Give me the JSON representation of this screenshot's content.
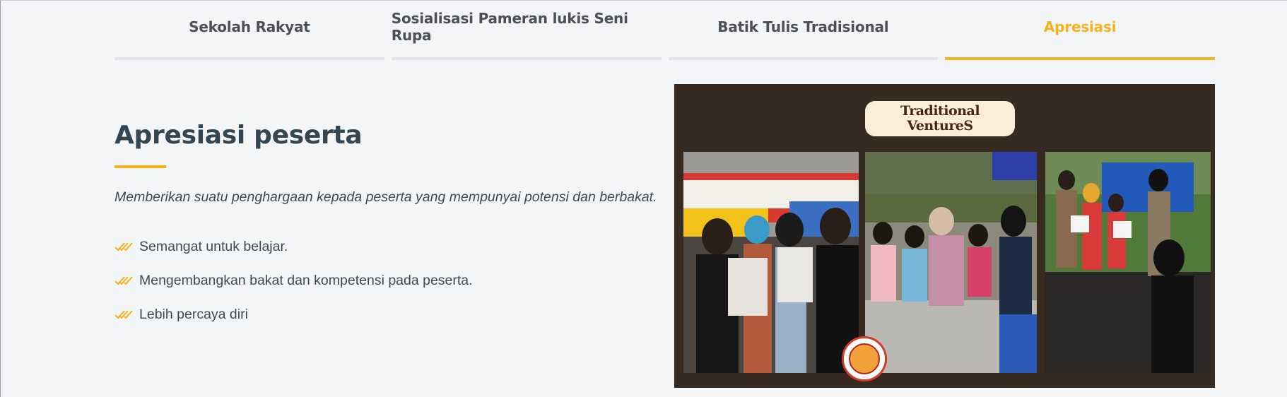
{
  "tabs": [
    {
      "label": "Sekolah Rakyat",
      "active": false
    },
    {
      "label": "Sosialisasi Pameran lukis Seni Rupa",
      "active": false
    },
    {
      "label": "Batik Tulis Tradisional",
      "active": false
    },
    {
      "label": "Apresiasi",
      "active": true
    }
  ],
  "content": {
    "heading": "Apresiasi peserta",
    "description": "Memberikan suatu penghargaan kepada peserta yang mempunyai potensi dan berbakat.",
    "points": [
      "Semangat untuk belajar.",
      "Mengembangkan bakat dan kompetensi pada peserta.",
      "Lebih percaya diri"
    ]
  },
  "image": {
    "logo_line1": "Traditional",
    "logo_line2": "VentureS",
    "icon": "photo-collage"
  },
  "colors": {
    "accent": "#f6b21b",
    "heading": "#344652",
    "text": "#3d4a55",
    "tab_text": "#4b4f56",
    "photo_bg": "#372a20"
  }
}
